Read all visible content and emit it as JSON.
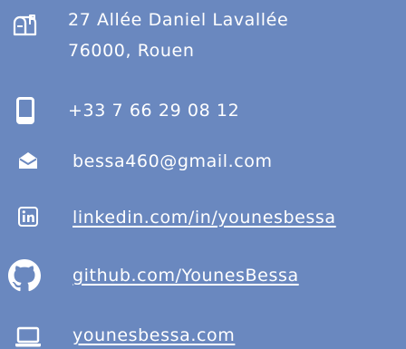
{
  "contact": {
    "address": {
      "icon": "mailbox-icon",
      "line1": "27 Allée Daniel Lavallée",
      "line2": "76000, Rouen"
    },
    "phone": {
      "icon": "smartphone-icon",
      "text": "+33 7 66 29 08 12"
    },
    "email": {
      "icon": "envelope-icon",
      "text": "bessa460@gmail.com"
    },
    "linkedin": {
      "icon": "linkedin-icon",
      "text": "linkedin.com/in/younesbessa"
    },
    "github": {
      "icon": "github-icon",
      "text": "github.com/YounesBessa"
    },
    "website": {
      "icon": "laptop-icon",
      "text": "younesbessa.com"
    }
  },
  "colors": {
    "background": "#6a88bf",
    "text": "#ffffff"
  }
}
